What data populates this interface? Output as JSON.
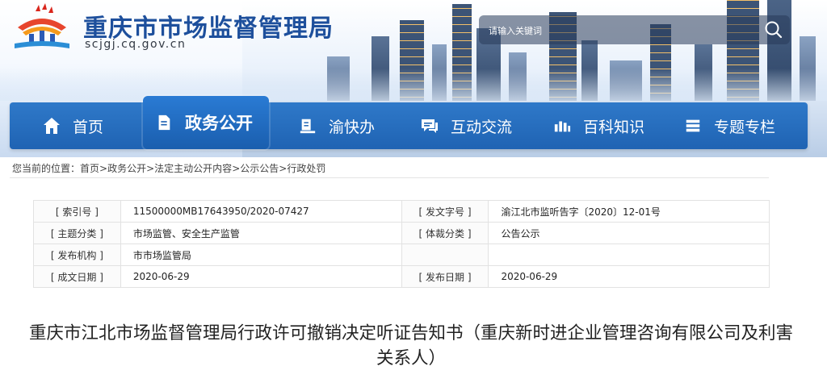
{
  "header": {
    "site_title": "重庆市市场监督管理局",
    "site_domain": "scjgj.cq.gov.cn",
    "search_placeholder": "请输入关键词"
  },
  "nav": [
    {
      "label": "首页",
      "icon": "home-icon"
    },
    {
      "label": "政务公开",
      "icon": "document-icon",
      "active": true
    },
    {
      "label": "渝快办",
      "icon": "service-icon"
    },
    {
      "label": "互动交流",
      "icon": "chat-icon"
    },
    {
      "label": "百科知识",
      "icon": "knowledge-icon"
    },
    {
      "label": "专题专栏",
      "icon": "column-icon"
    }
  ],
  "breadcrumb": {
    "prefix": "您当前的位置：",
    "items": [
      "首页",
      "政务公开",
      "法定主动公开内容",
      "公示公告",
      "行政处罚"
    ],
    "sep": ">"
  },
  "info_table": {
    "rows": [
      {
        "k1": "[ 索引号 ]",
        "v1": "11500000MB17643950/2020-07427",
        "k2": "[ 发文字号 ]",
        "v2": "渝江北市监听告字〔2020〕12-01号"
      },
      {
        "k1": "[ 主题分类 ]",
        "v1": "市场监管、安全生产监管",
        "k2": "[ 体裁分类 ]",
        "v2": "公告公示"
      },
      {
        "k1": "[ 发布机构 ]",
        "v1": "市市场监管局",
        "k2": "",
        "v2": ""
      },
      {
        "k1": "[ 成文日期 ]",
        "v1": "2020-06-29",
        "k2": "[ 发布日期 ]",
        "v2": "2020-06-29"
      }
    ]
  },
  "article": {
    "title": "重庆市江北市场监督管理局行政许可撤销决定听证告知书（重庆新时进企业管理咨询有限公司及利害关系人）"
  },
  "colors": {
    "brand_blue": "#1d4f9c",
    "nav_blue": "#1f63b3"
  }
}
